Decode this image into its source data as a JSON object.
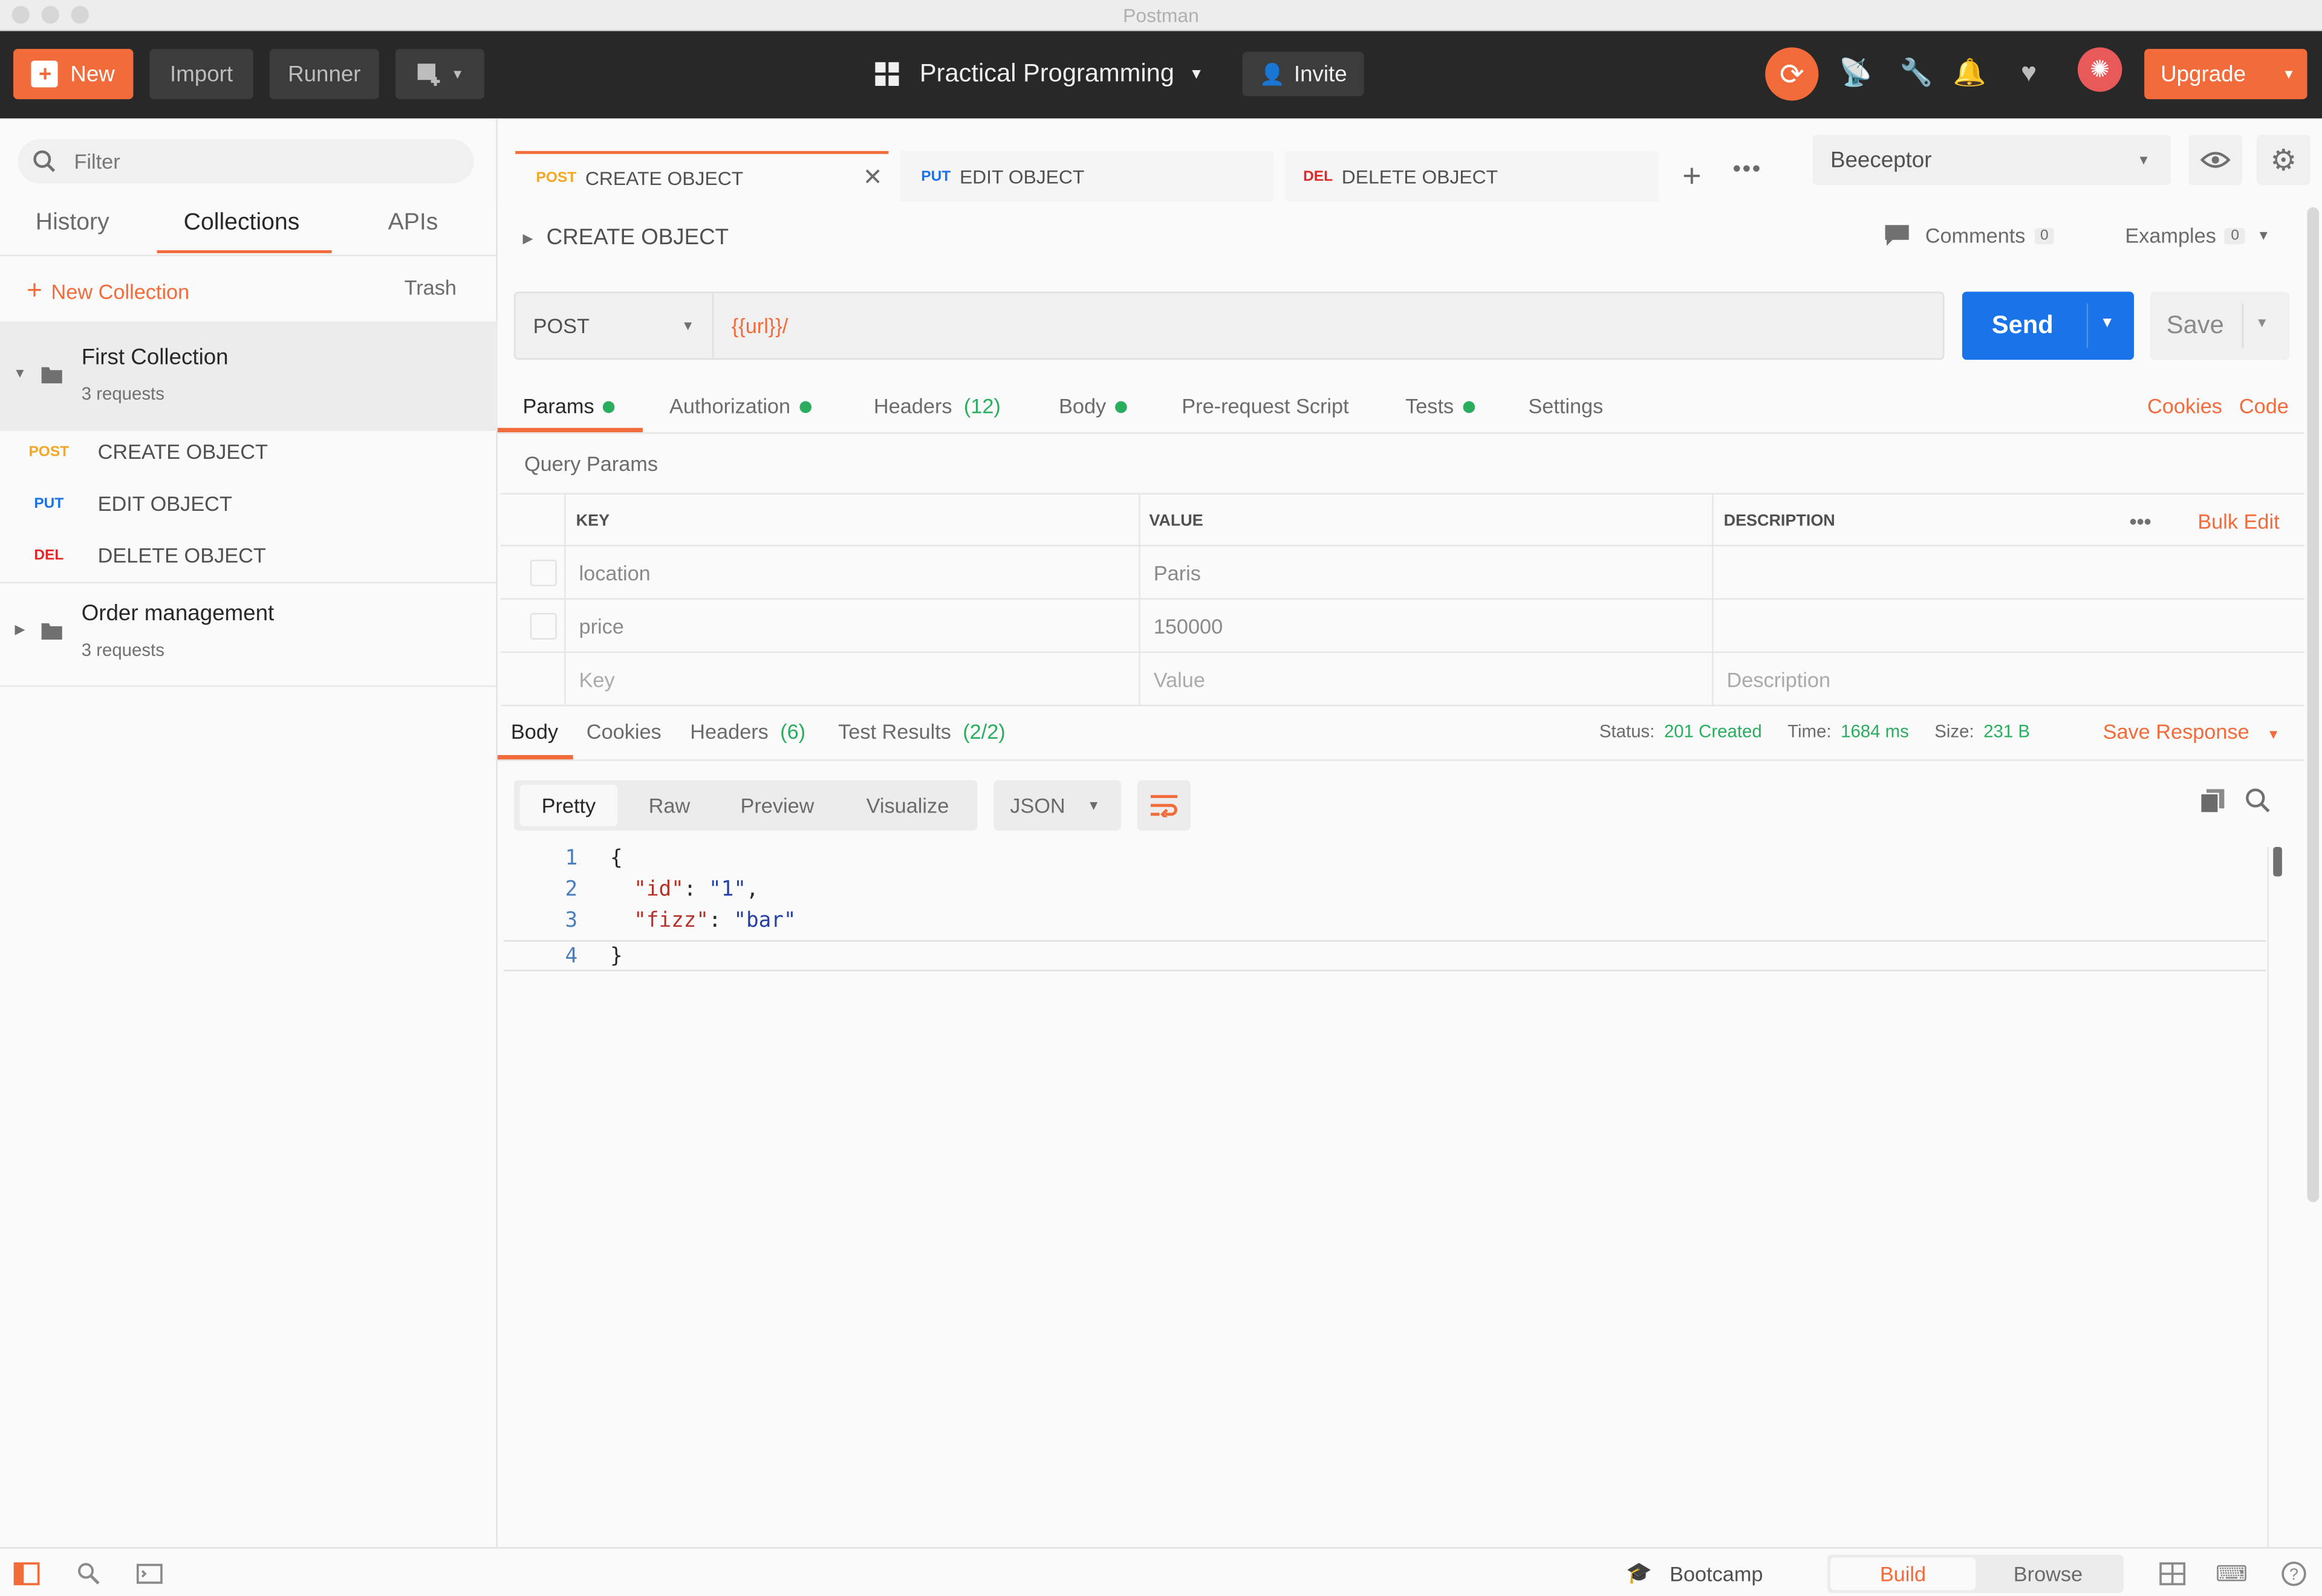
{
  "window": {
    "title": "Postman"
  },
  "header": {
    "new_label": "New",
    "import_label": "Import",
    "runner_label": "Runner",
    "workspace": "Practical Programming",
    "invite_label": "Invite",
    "upgrade_label": "Upgrade"
  },
  "sidebar": {
    "filter_placeholder": "Filter",
    "tabs": [
      "History",
      "Collections",
      "APIs"
    ],
    "new_collection": "New Collection",
    "trash": "Trash",
    "collections": [
      {
        "name": "First Collection",
        "count": "3 requests",
        "requests": [
          {
            "method": "POST",
            "name": "CREATE OBJECT"
          },
          {
            "method": "PUT",
            "name": "EDIT OBJECT"
          },
          {
            "method": "DEL",
            "name": "DELETE OBJECT"
          }
        ]
      },
      {
        "name": "Order management",
        "count": "3 requests"
      }
    ]
  },
  "tabs": [
    {
      "method": "POST",
      "name": "CREATE OBJECT"
    },
    {
      "method": "PUT",
      "name": "EDIT OBJECT"
    },
    {
      "method": "DEL",
      "name": "DELETE OBJECT"
    }
  ],
  "environment": "Beeceptor",
  "request": {
    "title": "CREATE OBJECT",
    "comments_label": "Comments",
    "comments_count": "0",
    "examples_label": "Examples",
    "examples_count": "0",
    "method": "POST",
    "url": "{{url}}/",
    "send_label": "Send",
    "save_label": "Save",
    "tabs": {
      "params": "Params",
      "authorization": "Authorization",
      "headers": "Headers",
      "headers_count": "(12)",
      "body": "Body",
      "prerequest": "Pre-request Script",
      "tests": "Tests",
      "settings": "Settings"
    },
    "cookies_link": "Cookies",
    "code_link": "Code",
    "query_params_title": "Query Params",
    "columns": [
      "KEY",
      "VALUE",
      "DESCRIPTION"
    ],
    "bulk_edit": "Bulk Edit",
    "params": [
      {
        "key": "location",
        "value": "Paris"
      },
      {
        "key": "price",
        "value": "150000"
      }
    ],
    "placeholders": {
      "key": "Key",
      "value": "Value",
      "description": "Description"
    }
  },
  "response": {
    "tabs": {
      "body": "Body",
      "cookies": "Cookies",
      "headers": "Headers",
      "headers_count": "(6)",
      "test_results": "Test Results",
      "test_results_count": "(2/2)"
    },
    "status_label": "Status:",
    "status_value": "201 Created",
    "time_label": "Time:",
    "time_value": "1684 ms",
    "size_label": "Size:",
    "size_value": "231 B",
    "save_response": "Save Response",
    "view_modes": [
      "Pretty",
      "Raw",
      "Preview",
      "Visualize"
    ],
    "format": "JSON",
    "lines": [
      {
        "n": "1",
        "text": "{"
      },
      {
        "n": "2",
        "key": "\"id\"",
        "sep": ": ",
        "val": "\"1\"",
        "end": ","
      },
      {
        "n": "3",
        "key": "\"fizz\"",
        "sep": ": ",
        "val": "\"bar\"",
        "end": ""
      },
      {
        "n": "4",
        "text": "}"
      }
    ]
  },
  "footer": {
    "bootcamp": "Bootcamp",
    "build": "Build",
    "browse": "Browse"
  },
  "colors": {
    "accent": "#f26b3a",
    "send_blue": "#1a73e8",
    "post": "#f5a623",
    "put": "#1a73e8",
    "del": "#e02828",
    "success": "#2bad5f"
  }
}
